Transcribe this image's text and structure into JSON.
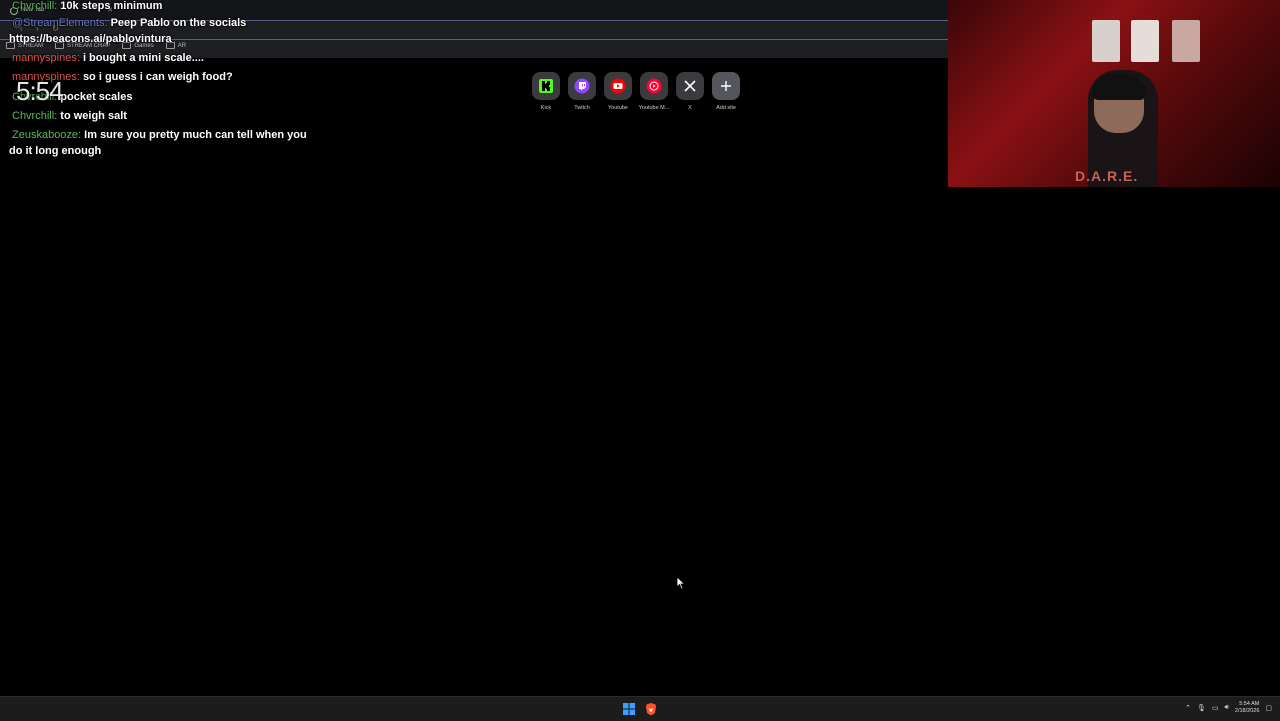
{
  "browser": {
    "tab_title": "New Tab",
    "bookmarks": [
      "STREAM",
      "STREAM CRAP",
      "Games",
      "AR"
    ]
  },
  "chat": {
    "lines": [
      {
        "user": "Chvrchill:",
        "message": "10k steps minimum",
        "user_color": "#5cb85c"
      },
      {
        "user": "@StreamElements:",
        "message": "Peep Pablo on the socials",
        "user_color": "#6a78c8"
      },
      {
        "user": "",
        "message": "https://beacons.ai/pablovintura",
        "user_color": "#ffffff"
      },
      {
        "user": "mannyspines:",
        "message": "i bought a mini scale....",
        "user_color": "#d9534f"
      },
      {
        "user": "mannyspines:",
        "message": "so i guess i can weigh food?",
        "user_color": "#d9534f"
      },
      {
        "user": "Chvrchill:",
        "message": "pocket scales",
        "user_color": "#5cb85c"
      },
      {
        "user": "Chvrchill:",
        "message": "to weigh salt",
        "user_color": "#5cb85c"
      },
      {
        "user": "Zeuskabooze:",
        "message": "Im sure you pretty much can tell when you",
        "user_color": "#5cb85c"
      },
      {
        "user": "",
        "message": "do it long enough",
        "user_color": "#ffffff"
      }
    ]
  },
  "overlay_clock": "5:54",
  "shortcuts": [
    {
      "label": "Kick",
      "icon": "kick-icon",
      "color": "#53fc18"
    },
    {
      "label": "Twitch",
      "icon": "twitch-icon",
      "color": "#9146ff"
    },
    {
      "label": "Youtube",
      "icon": "youtube-icon",
      "color": "#ff0000"
    },
    {
      "label": "Youtube M...",
      "icon": "youtube-music-icon",
      "color": "#ff0033"
    },
    {
      "label": "X",
      "icon": "x-icon",
      "color": "#ffffff"
    },
    {
      "label": "Add site",
      "icon": "plus-icon",
      "color": "#ffffff"
    }
  ],
  "webcam": {
    "shirt_text": "D.A.R.E."
  },
  "taskbar": {
    "time": "5:54 AM",
    "date": "2/18/2026"
  }
}
